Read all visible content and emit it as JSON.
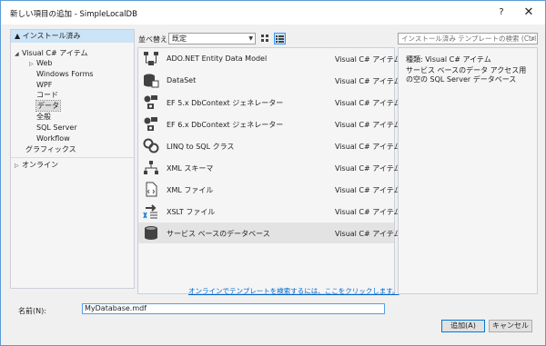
{
  "window": {
    "title": "新しい項目の追加 - SimpleLocalDB",
    "help_glyph": "?",
    "close_glyph": "✕"
  },
  "left_pane": {
    "installed_header": "▲ インストール済み",
    "tree": [
      {
        "label": "Visual C# アイテム",
        "toggle": "◢"
      },
      {
        "label": "Web",
        "toggle": "▷"
      },
      {
        "label": "Windows Forms",
        "toggle": ""
      },
      {
        "label": "WPF",
        "toggle": ""
      },
      {
        "label": "コード",
        "toggle": ""
      },
      {
        "label": "データ",
        "toggle": "",
        "selected": true
      },
      {
        "label": "全般",
        "toggle": ""
      },
      {
        "label": "SQL Server",
        "toggle": ""
      },
      {
        "label": "Workflow",
        "toggle": ""
      },
      {
        "label": "グラフィックス",
        "toggle": ""
      }
    ],
    "online": {
      "label": "オンライン",
      "toggle": "▷"
    }
  },
  "toolbar": {
    "sort_label": "並べ替え:",
    "sort_value": "既定",
    "search_placeholder": "インストール済み テンプレートの検索 (Ctrl+E"
  },
  "templates": [
    {
      "name": "ADO.NET Entity Data Model",
      "type": "Visual C# アイテム",
      "icon": "entity-model-icon"
    },
    {
      "name": "DataSet",
      "type": "Visual C# アイテム",
      "icon": "dataset-icon"
    },
    {
      "name": "EF 5.x DbContext ジェネレーター",
      "type": "Visual C# アイテム",
      "icon": "ef-generator-icon"
    },
    {
      "name": "EF 6.x DbContext ジェネレーター",
      "type": "Visual C# アイテム",
      "icon": "ef-generator-icon"
    },
    {
      "name": "LINQ to SQL クラス",
      "type": "Visual C# アイテム",
      "icon": "linq-icon"
    },
    {
      "name": "XML スキーマ",
      "type": "Visual C# アイテム",
      "icon": "xml-schema-icon"
    },
    {
      "name": "XML ファイル",
      "type": "Visual C# アイテム",
      "icon": "xml-file-icon"
    },
    {
      "name": "XSLT ファイル",
      "type": "Visual C# アイテム",
      "icon": "xslt-icon"
    },
    {
      "name": "サービス ベースのデータベース",
      "type": "Visual C# アイテム",
      "icon": "database-icon",
      "selected": true
    }
  ],
  "online_link": "オンラインでテンプレートを検索するには、ここをクリックします。",
  "description": {
    "type_line": "種類: Visual C# アイテム",
    "text": "サービス ベースのデータ アクセス用の空の SQL Server データベース"
  },
  "name_field": {
    "label": "名前(N):",
    "value": "MyDatabase.mdf"
  },
  "buttons": {
    "add": "追加(A)",
    "cancel": "キャンセル"
  },
  "colors": {
    "accent": "#0078d7",
    "selection": "#cce4f7",
    "link": "#0066cc"
  }
}
